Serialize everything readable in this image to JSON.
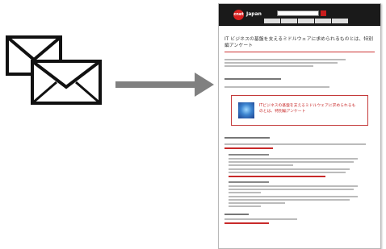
{
  "colors": {
    "accent": "#c82a2a",
    "header_bg": "#1a1a1a",
    "arrow": "#808080"
  },
  "icons": {
    "envelopes": "envelope-stack-icon",
    "arrow": "right-arrow-icon",
    "banner": "globe-icon"
  },
  "site": {
    "logo_badge": "cnet",
    "logo_text": "Japan"
  },
  "page": {
    "title": "IT ビジネスの基盤を支えるミドルウェアに求められるものとは、特別編アンケート",
    "banner_text": "ITビジネスの基盤を支えるミドルウェアに求められるものとは、特別編アンケート"
  }
}
